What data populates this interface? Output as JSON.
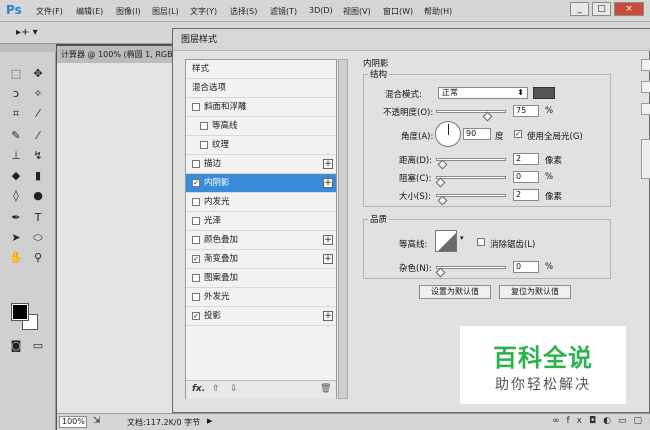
{
  "app": {
    "logo": "Ps"
  },
  "menubar": {
    "items": [
      "文件(F)",
      "编辑(E)",
      "图像(I)",
      "图层(L)",
      "文字(Y)",
      "选择(S)",
      "滤镜(T)",
      "3D(D)",
      "视图(V)",
      "窗口(W)",
      "帮助(H)"
    ],
    "minimize": "_",
    "maximize": "□",
    "close": "×"
  },
  "optionsbar": {
    "tool": "▸+ ▾"
  },
  "document": {
    "tab": "计算器 @ 100% (椭圆 1, RGB"
  },
  "status": {
    "zoom": "100%",
    "doc_info": "文档:117.2K/0 字节",
    "arrow": "▶"
  },
  "dialog": {
    "title": "图层样式",
    "styles": [
      {
        "label": "样式",
        "checkbox": false,
        "checked": false,
        "plus": false,
        "indent": 0
      },
      {
        "label": "混合选项",
        "checkbox": false,
        "checked": false,
        "plus": false,
        "indent": 0
      },
      {
        "label": "斜面和浮雕",
        "checkbox": true,
        "checked": false,
        "plus": false,
        "indent": 0
      },
      {
        "label": "等高线",
        "checkbox": true,
        "checked": false,
        "plus": false,
        "indent": 1
      },
      {
        "label": "纹理",
        "checkbox": true,
        "checked": false,
        "plus": false,
        "indent": 1
      },
      {
        "label": "描边",
        "checkbox": true,
        "checked": false,
        "plus": true,
        "indent": 0
      },
      {
        "label": "内阴影",
        "checkbox": true,
        "checked": true,
        "plus": true,
        "indent": 0,
        "selected": true
      },
      {
        "label": "内发光",
        "checkbox": true,
        "checked": false,
        "plus": false,
        "indent": 0
      },
      {
        "label": "光泽",
        "checkbox": true,
        "checked": false,
        "plus": false,
        "indent": 0
      },
      {
        "label": "颜色叠加",
        "checkbox": true,
        "checked": false,
        "plus": true,
        "indent": 0
      },
      {
        "label": "渐变叠加",
        "checkbox": true,
        "checked": true,
        "plus": true,
        "indent": 0
      },
      {
        "label": "图案叠加",
        "checkbox": true,
        "checked": false,
        "plus": false,
        "indent": 0
      },
      {
        "label": "外发光",
        "checkbox": true,
        "checked": false,
        "plus": false,
        "indent": 0
      },
      {
        "label": "投影",
        "checkbox": true,
        "checked": true,
        "plus": true,
        "indent": 0
      }
    ],
    "footer": {
      "fx": "fx.",
      "up": "⇧",
      "down": "⇩",
      "trash": "🗑"
    },
    "inner_shadow": {
      "title": "内阴影",
      "structure": {
        "title": "结构",
        "blend_mode_label": "混合模式:",
        "blend_mode_value": "正常",
        "shadow_color": "#555555",
        "opacity_label": "不透明度(O):",
        "opacity_value": "75",
        "opacity_unit": "%",
        "opacity_fraction": 0.75,
        "angle_label": "角度(A):",
        "angle_value": "90",
        "angle_unit": "度",
        "global_light_label": "使用全局光(G)",
        "global_light_checked": true,
        "distance_label": "距离(D):",
        "distance_value": "2",
        "distance_unit": "像素",
        "choke_label": "阻塞(C):",
        "choke_value": "0",
        "choke_unit": "%",
        "size_label": "大小(S):",
        "size_value": "2",
        "size_unit": "像素"
      },
      "quality": {
        "title": "品质",
        "contour_label": "等高线:",
        "antialias_label": "消除锯齿(L)",
        "noise_label": "杂色(N):",
        "noise_value": "0",
        "noise_unit": "%"
      },
      "set_default": "设置为默认值",
      "reset_default": "复位为默认值"
    }
  },
  "watermark": {
    "title": "百科全说",
    "subtitle": "助你轻松解决"
  }
}
